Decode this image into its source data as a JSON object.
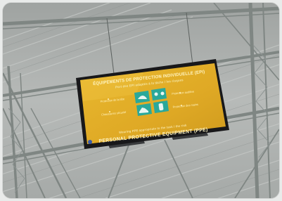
{
  "sign": {
    "title": "ÉQUIPEMENTS DE PROTECTION INDIVIDUELLE (EPI)",
    "subtitle": "Port des EPI adaptés à la tâche / les risques",
    "items_left": [
      "Protection de la tête",
      "Chaussures sécurité"
    ],
    "items_right": [
      "Protection auditive",
      "Protection des mains"
    ],
    "footer_line": "Wearing PPE appropriate to the task / the risk",
    "footer_title": "PERSONAL PROTECTIVE EQUIPMENT (PPE)"
  },
  "colors": {
    "screen_yellow": "#e4b12a",
    "screen_dark": "#c8951c",
    "icon_teal": "#2aa89a",
    "bezel": "#1b1b1d",
    "ceiling": "#b3b6b4",
    "steel": "#8f9694"
  },
  "icons": [
    "hard-hat-icon",
    "ear-protection-icon",
    "safety-shoe-icon",
    "glove-icon"
  ]
}
